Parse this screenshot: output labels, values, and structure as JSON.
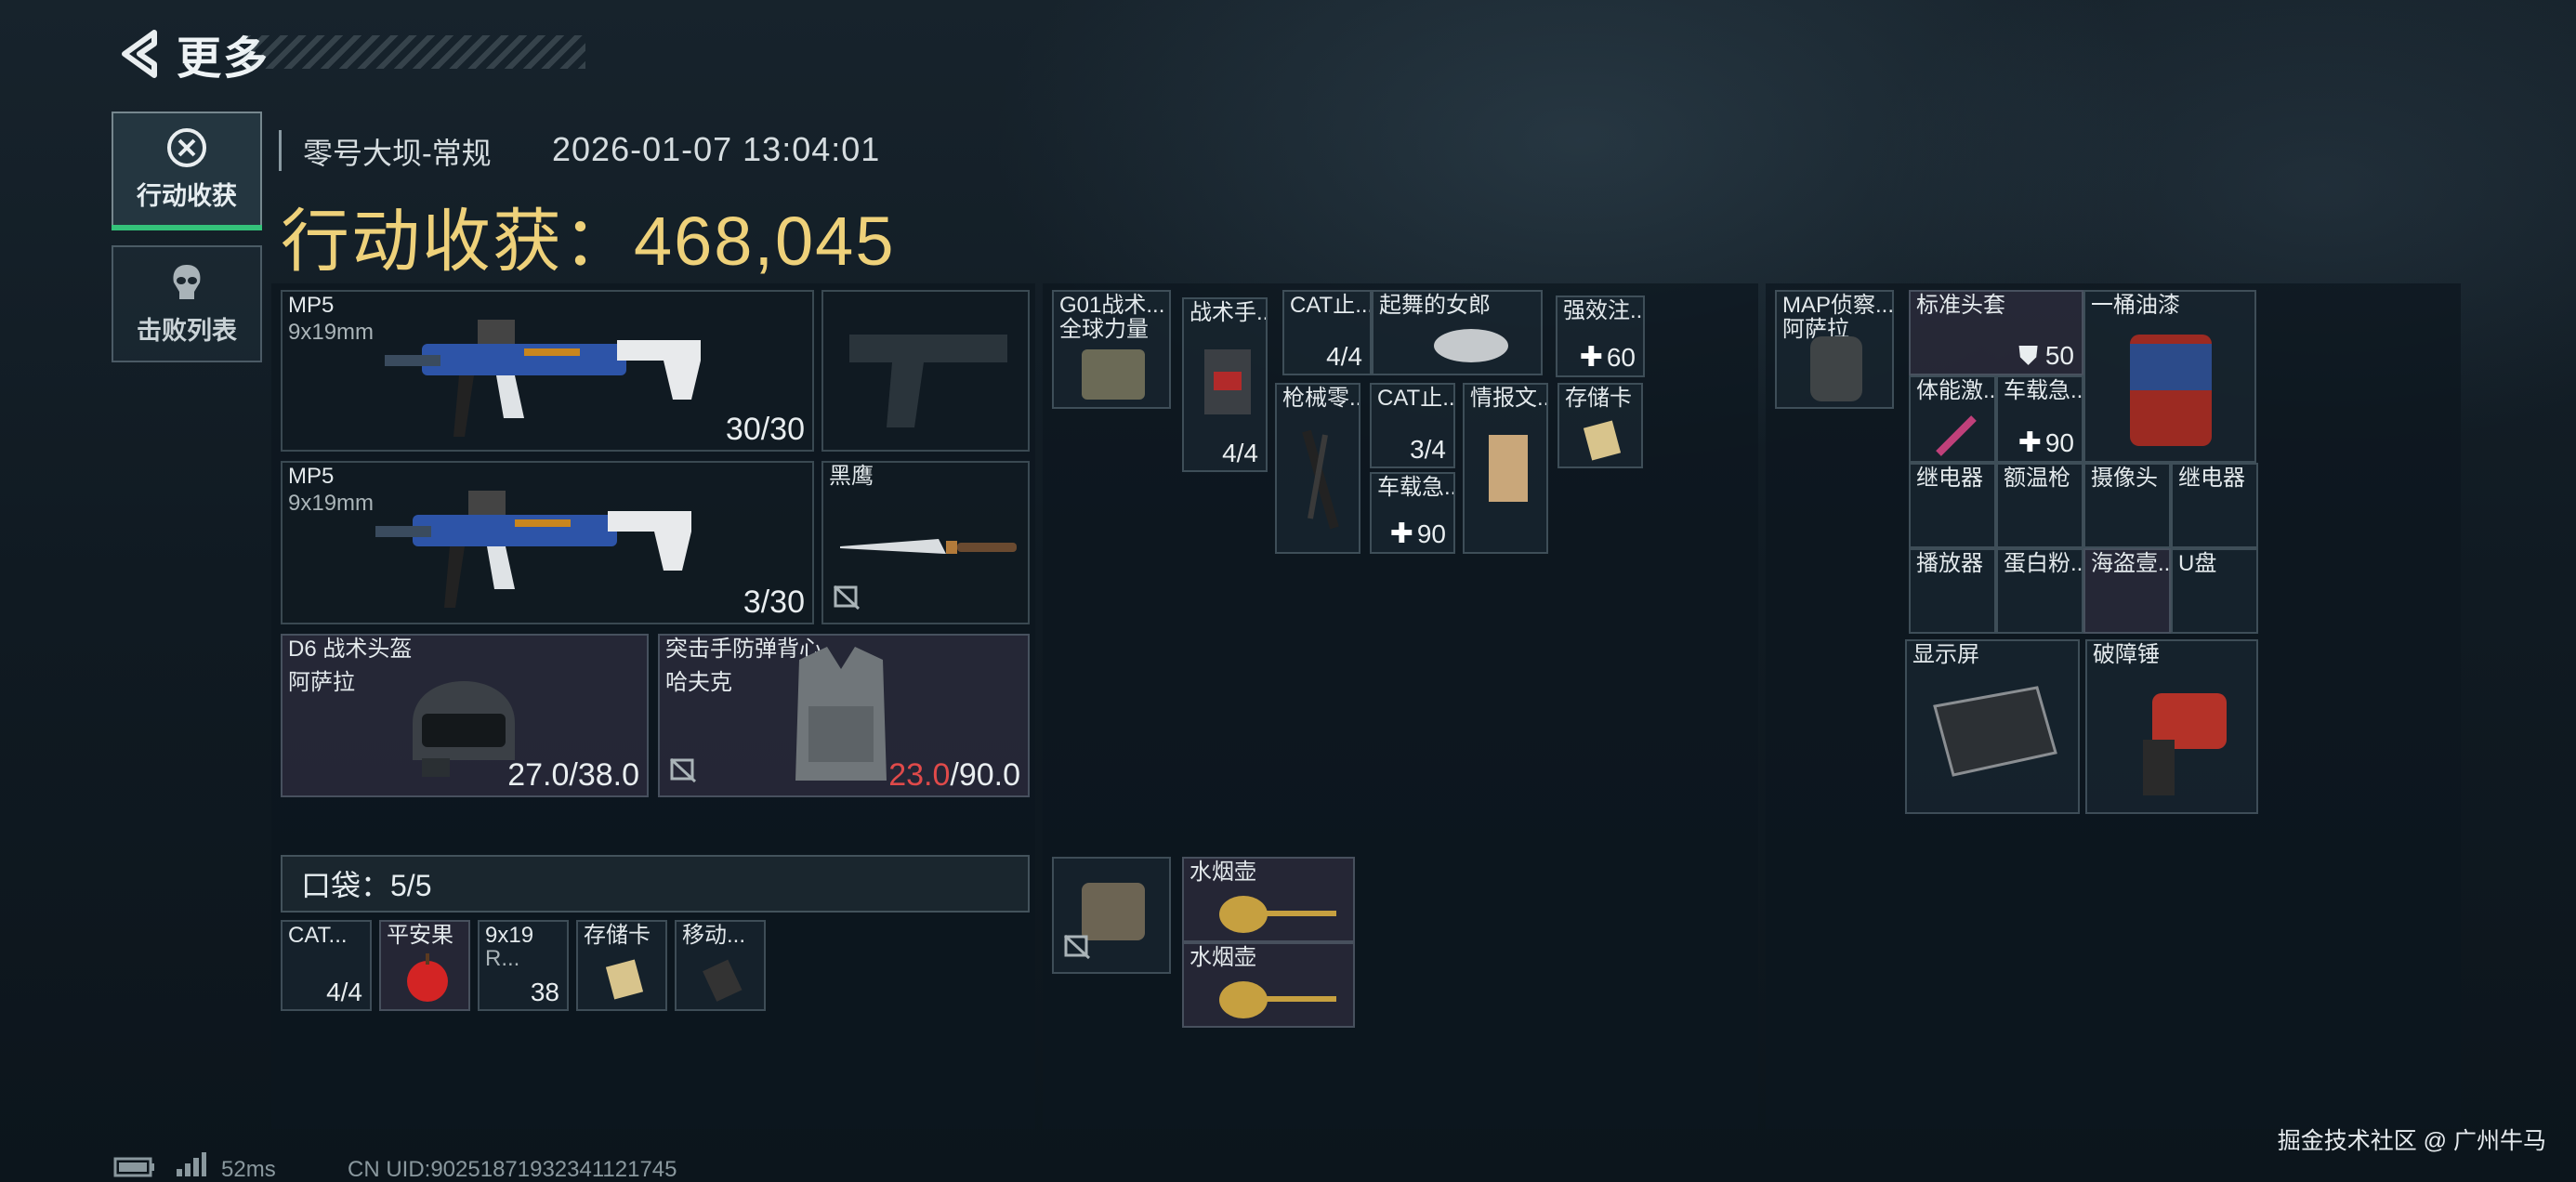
{
  "header": {
    "title": "更多"
  },
  "tabs": [
    {
      "label": "行动收获",
      "active": true
    },
    {
      "label": "击败列表",
      "active": false
    }
  ],
  "raid": {
    "map": "零号大坝-常规",
    "datetime": "2026-01-07 13:04:01",
    "gain_label": "行动收获：",
    "gain_value": "468,045"
  },
  "equipment": {
    "primary1": {
      "name": "MP5",
      "ammo": "9x19mm",
      "count": "30/30"
    },
    "primary2": {
      "name": "MP5",
      "ammo": "9x19mm",
      "count": "3/30"
    },
    "melee": {
      "name": "黑鹰"
    },
    "helmet": {
      "name": "D6 战术头盔",
      "sub": "阿萨拉",
      "durability": "27.0/38.0"
    },
    "armor": {
      "name": "突击手防弹背心",
      "sub": "哈夫克",
      "durability_current": "23.0",
      "durability_max": "/90.0"
    }
  },
  "pocket": {
    "label": "口袋：5/5",
    "items": [
      {
        "name": "CAT...",
        "count": "4/4"
      },
      {
        "name": "平安果",
        "count": ""
      },
      {
        "name": "9x19",
        "sub": "R...",
        "count": "38"
      },
      {
        "name": "存储卡",
        "count": ""
      },
      {
        "name": "移动...",
        "count": ""
      }
    ]
  },
  "rig": {
    "items": [
      {
        "name": "G01战术...",
        "sub": "全球力量"
      },
      {
        "name": "战术手...",
        "count": "4/4"
      },
      {
        "name": "CAT止...",
        "count": "4/4"
      },
      {
        "name": "起舞的女郎"
      },
      {
        "name": "强效注...",
        "count": "60"
      },
      {
        "name": "枪械零..."
      },
      {
        "name": "CAT止...",
        "count": "3/4"
      },
      {
        "name": "情报文..."
      },
      {
        "name": "存储卡"
      },
      {
        "name": "车载急...",
        "count": "90"
      }
    ]
  },
  "vest_pouch": {
    "items": [
      {
        "name": "水烟壶"
      },
      {
        "name": "水烟壶"
      }
    ]
  },
  "backpack": {
    "name": "MAP侦察...",
    "sub": "阿萨拉",
    "items": [
      {
        "name": "标准头套",
        "count": "50"
      },
      {
        "name": "一桶油漆"
      },
      {
        "name": "体能激..."
      },
      {
        "name": "车载急...",
        "count": "90"
      },
      {
        "name": "继电器"
      },
      {
        "name": "额温枪"
      },
      {
        "name": "摄像头"
      },
      {
        "name": "继电器"
      },
      {
        "name": "播放器"
      },
      {
        "name": "蛋白粉..."
      },
      {
        "name": "海盗壹..."
      },
      {
        "name": "U盘"
      },
      {
        "name": "显示屏"
      },
      {
        "name": "破障锤"
      }
    ]
  },
  "footer": {
    "ping": "52ms",
    "uid": "CN UID:9025187193234112174​5"
  },
  "watermark": "掘金技术社区 @ 广州牛马",
  "colors": {
    "gold": "#eed17a",
    "red": "#e04a4a",
    "green": "#34c27a"
  }
}
